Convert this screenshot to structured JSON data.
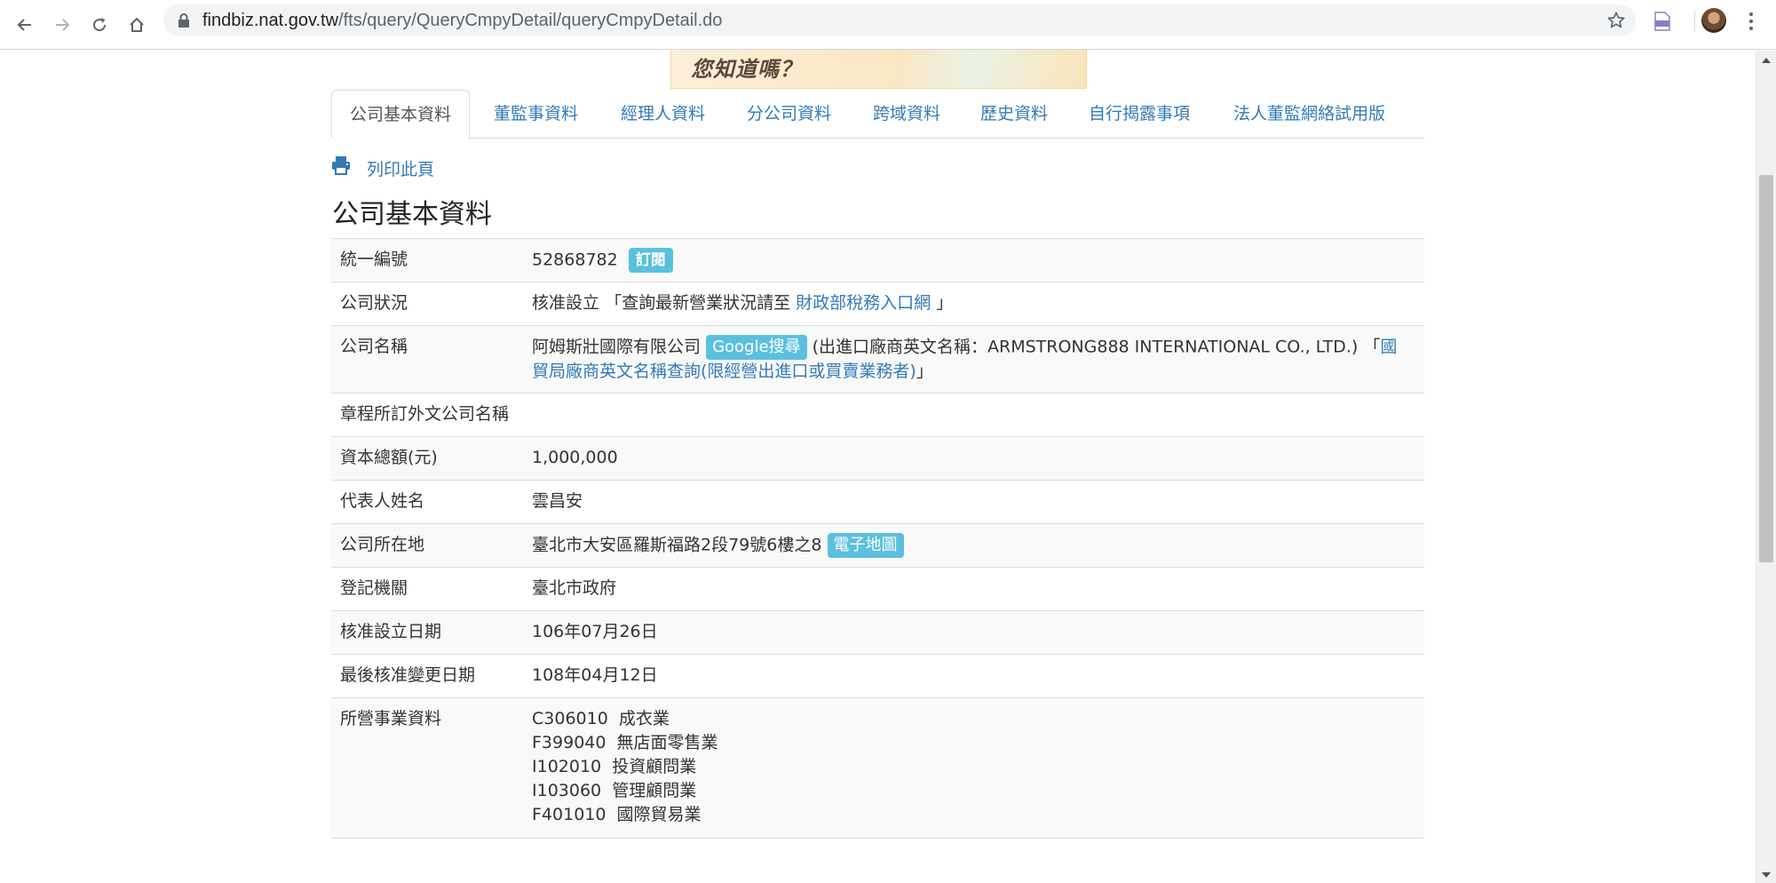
{
  "browser": {
    "url_host": "findbiz.nat.gov.tw",
    "url_path": "/fts/query/QueryCmpyDetail/queryCmpyDetail.do"
  },
  "banner": {
    "text": "您知道嗎？"
  },
  "tabs": [
    {
      "label": "公司基本資料",
      "active": true
    },
    {
      "label": "董監事資料"
    },
    {
      "label": "經理人資料"
    },
    {
      "label": "分公司資料"
    },
    {
      "label": "跨域資料"
    },
    {
      "label": "歷史資料"
    },
    {
      "label": "自行揭露事項"
    },
    {
      "label": "法人董監網絡試用版"
    }
  ],
  "print_label": "列印此頁",
  "section_title": "公司基本資料",
  "rows": {
    "ubn": {
      "label": "統一編號",
      "value": "52868782",
      "subscribe": "訂閱"
    },
    "status": {
      "label": "公司狀況",
      "value": "核准設立",
      "prefix": "「查詢最新營業狀況請至",
      "link": "財政部稅務入口網",
      "suffix": "」"
    },
    "name": {
      "label": "公司名稱",
      "value": "阿姆斯壯國際有限公司",
      "google": "Google搜尋",
      "english": "(出進口廠商英文名稱：ARMSTRONG888 INTERNATIONAL CO., LTD.)",
      "open": "「",
      "link": "國貿局廠商英文名稱查詢(限經營出進口或買賣業務者)",
      "close": "」"
    },
    "foreign_name": {
      "label": "章程所訂外文公司名稱",
      "value": ""
    },
    "capital": {
      "label": "資本總額(元)",
      "value": "1,000,000"
    },
    "representative": {
      "label": "代表人姓名",
      "value": "雲昌安"
    },
    "address": {
      "label": "公司所在地",
      "value": "臺北市大安區羅斯福路2段79號6樓之8",
      "map": "電子地圖"
    },
    "authority": {
      "label": "登記機關",
      "value": "臺北市政府"
    },
    "approved_date": {
      "label": "核准設立日期",
      "value": "106年07月26日"
    },
    "changed_date": {
      "label": "最後核准變更日期",
      "value": "108年04月12日"
    },
    "business": {
      "label": "所營事業資料",
      "items": [
        "C306010  成衣業",
        "F399040  無店面零售業",
        "I102010  投資顧問業",
        "I103060  管理顧問業",
        "F401010  國際貿易業"
      ]
    }
  },
  "colors": {
    "link": "#337ab7",
    "badge": "#5bc0de",
    "row_stripe": "#f9f9f9",
    "border": "#dddddd"
  }
}
